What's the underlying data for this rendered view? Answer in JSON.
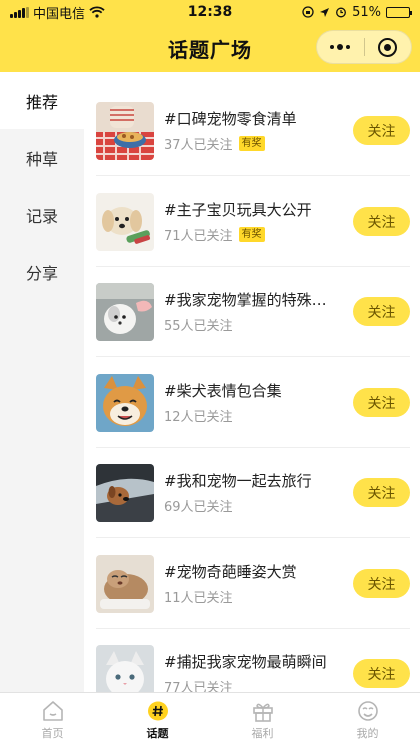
{
  "status_bar": {
    "carrier": "中国电信",
    "time": "12:38",
    "battery": "51%",
    "battery_level": 0.51
  },
  "nav": {
    "title": "话题广场"
  },
  "sidebar": {
    "items": [
      {
        "label": "推荐",
        "active": true
      },
      {
        "label": "种草",
        "active": false
      },
      {
        "label": "记录",
        "active": false
      },
      {
        "label": "分享",
        "active": false
      }
    ]
  },
  "topics": [
    {
      "title": "#口碑宠物零食清单",
      "followers": "37人已关注",
      "badge": "有奖",
      "button": "关注"
    },
    {
      "title": "#主子宝贝玩具大公开",
      "followers": "71人已关注",
      "badge": "有奖",
      "button": "关注"
    },
    {
      "title": "#我家宠物掌握的特殊技能",
      "followers": "55人已关注",
      "badge": "",
      "button": "关注"
    },
    {
      "title": "#柴犬表情包合集",
      "followers": "12人已关注",
      "badge": "",
      "button": "关注"
    },
    {
      "title": "#我和宠物一起去旅行",
      "followers": "69人已关注",
      "badge": "",
      "button": "关注"
    },
    {
      "title": "#宠物奇葩睡姿大赏",
      "followers": "11人已关注",
      "badge": "",
      "button": "关注"
    },
    {
      "title": "#捕捉我家宠物最萌瞬间",
      "followers": "77人已关注",
      "badge": "",
      "button": "关注"
    }
  ],
  "tabbar": {
    "tabs": [
      {
        "label": "首页",
        "icon": "home-icon",
        "active": false
      },
      {
        "label": "话题",
        "icon": "hashtag-icon",
        "active": true
      },
      {
        "label": "福利",
        "icon": "gift-icon",
        "active": false
      },
      {
        "label": "我的",
        "icon": "profile-icon",
        "active": false
      }
    ]
  },
  "colors": {
    "accent": "#FFE24A",
    "sidebar_bg": "#F4F4F4",
    "muted_text": "#9A9A9A"
  }
}
